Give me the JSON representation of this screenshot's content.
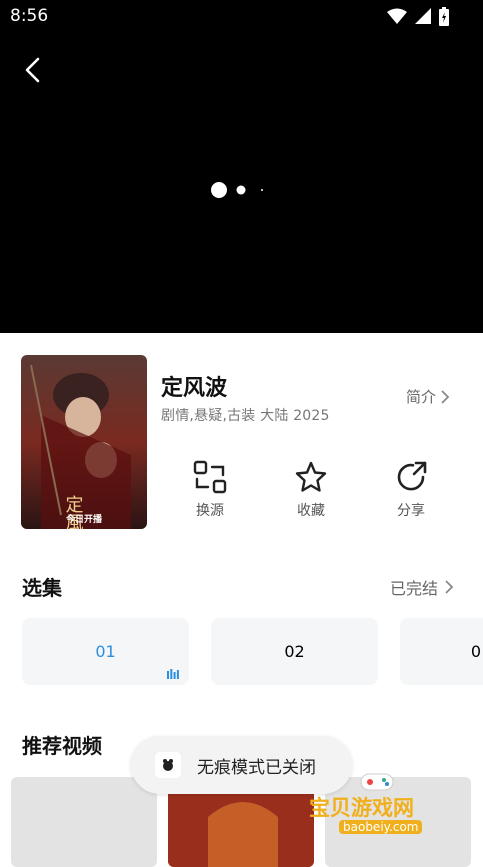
{
  "status_bar": {
    "time": "8:56"
  },
  "player": {
    "back_icon": "chevron-left-icon",
    "state": "loading"
  },
  "show": {
    "title": "定风波",
    "meta": "剧情,悬疑,古装  大陆  2025",
    "intro_label": "简介",
    "poster_caption": "今日开播"
  },
  "actions": [
    {
      "icon": "switch-source-icon",
      "label": "换源"
    },
    {
      "icon": "star-icon",
      "label": "收藏"
    },
    {
      "icon": "share-icon",
      "label": "分享"
    }
  ],
  "episodes": {
    "section_title": "选集",
    "status": "已完结",
    "items": [
      "01",
      "02",
      "0"
    ],
    "active_index": 0,
    "active_color": "#2b8fe0"
  },
  "recommend": {
    "section_title": "推荐视频"
  },
  "toast": {
    "text": "无痕模式已关闭"
  },
  "watermark": {
    "text": "宝贝游戏网",
    "url": "baobeiy.com"
  }
}
